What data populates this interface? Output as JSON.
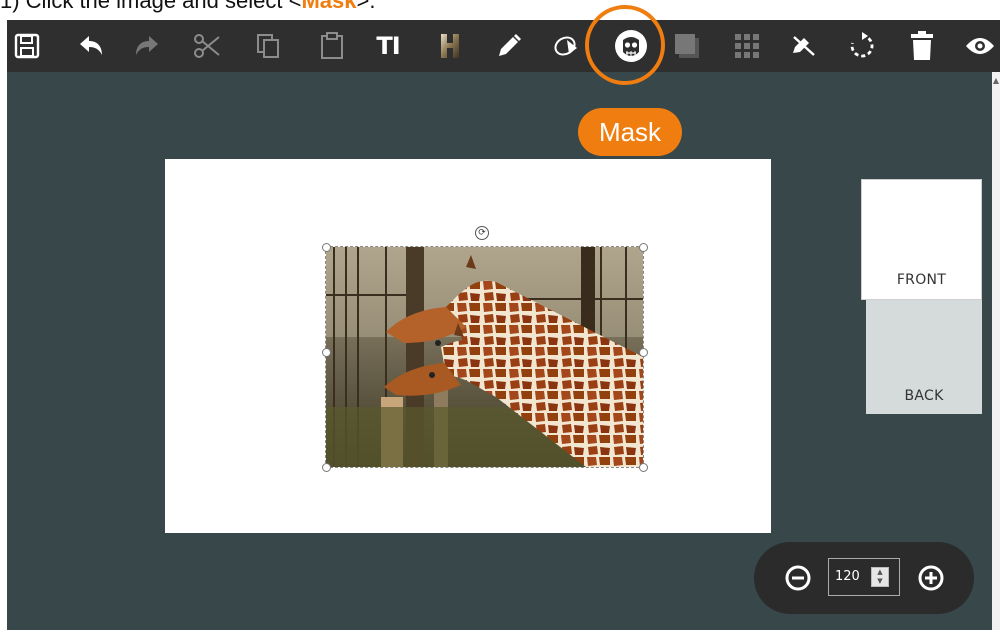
{
  "instruction": {
    "prefix": "1) Click the image and select <",
    "highlight": "Mask",
    "suffix": ">."
  },
  "toolbar": {
    "tools": [
      {
        "name": "save-icon"
      },
      {
        "name": "undo-icon"
      },
      {
        "name": "redo-icon"
      },
      {
        "name": "cut-icon"
      },
      {
        "name": "copy-icon"
      },
      {
        "name": "paste-icon"
      },
      {
        "name": "text-icon",
        "label": "TI"
      },
      {
        "name": "image-text-icon"
      },
      {
        "name": "pen-icon"
      },
      {
        "name": "fill-icon"
      },
      {
        "name": "mask-icon"
      },
      {
        "name": "shadow-icon"
      },
      {
        "name": "grid-icon"
      },
      {
        "name": "no-edit-icon"
      },
      {
        "name": "rotate-icon"
      },
      {
        "name": "delete-icon"
      },
      {
        "name": "preview-icon"
      }
    ]
  },
  "mask_callout": "Mask",
  "sides": {
    "front": "FRONT",
    "back": "BACK"
  },
  "zoom": {
    "value": "120"
  },
  "colors": {
    "accent": "#f07d10",
    "toolbar": "#2f2f2f",
    "workspace": "#37474a"
  }
}
